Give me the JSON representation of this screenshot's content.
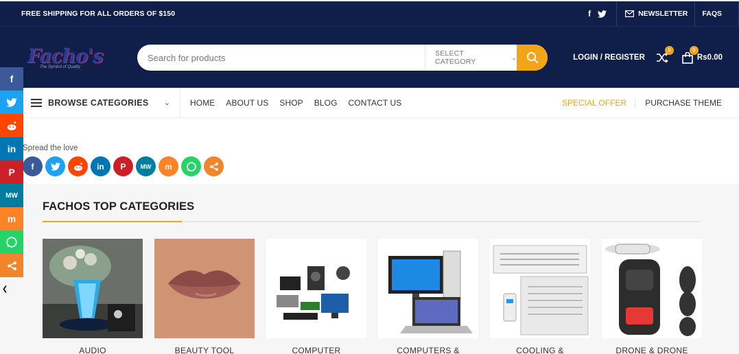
{
  "topbar": {
    "shipping": "FREE SHIPPING FOR ALL ORDERS OF $150",
    "newsletter": "NEWSLETTER",
    "faqs": "FAQS"
  },
  "header": {
    "logo_text": "Facho's",
    "logo_tagline": "The Symbol of Quality",
    "search_placeholder": "Search for products",
    "select_category": "SELECT CATEGORY",
    "login": "LOGIN / REGISTER",
    "compare_count": "0",
    "cart_count": "0",
    "cart_amount": "Rs0.00"
  },
  "nav": {
    "browse": "BROWSE CATEGORIES",
    "items": [
      "HOME",
      "ABOUT US",
      "SHOP",
      "BLOG",
      "CONTACT US"
    ],
    "special": "SPECIAL OFFER",
    "purchase": "PURCHASE THEME"
  },
  "share": {
    "spread": "Spread the love"
  },
  "categories": {
    "title": "FACHOS TOP CATEGORIES",
    "items": [
      {
        "name": "AUDIO"
      },
      {
        "name": "BEAUTY TOOL"
      },
      {
        "name": "COMPUTER"
      },
      {
        "name": "COMPUTERS &"
      },
      {
        "name": "COOLING &"
      },
      {
        "name": "DRONE & DRONE"
      }
    ]
  },
  "colors": {
    "navy": "#0f1f4a",
    "accent": "#f2a516"
  },
  "icons": {
    "facebook": "facebook-icon",
    "twitter": "twitter-icon",
    "reddit": "reddit-icon",
    "linkedin": "linkedin-icon",
    "pinterest": "pinterest-icon",
    "mewe": "mewe-icon",
    "mix": "mix-icon",
    "whatsapp": "whatsapp-icon",
    "share": "share-icon"
  }
}
